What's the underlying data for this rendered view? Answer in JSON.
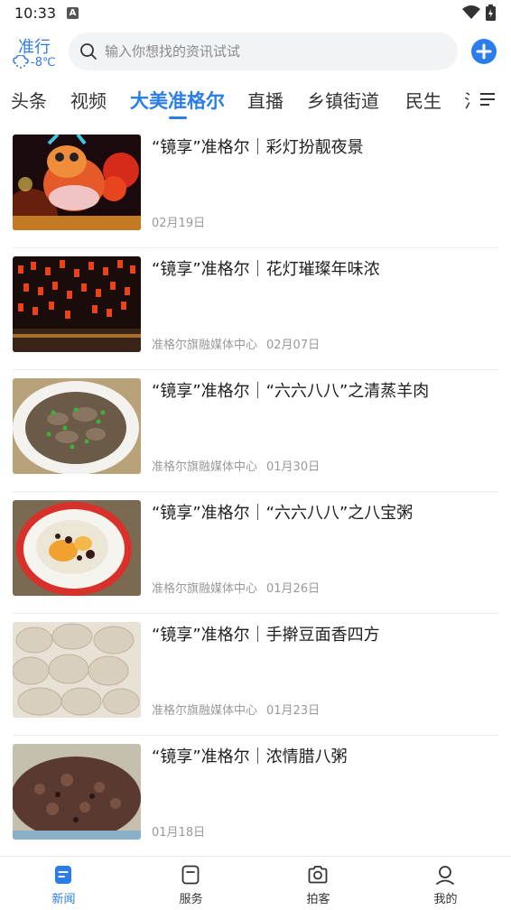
{
  "status_bar": {
    "time": "10:33",
    "notification_letter": "A"
  },
  "header": {
    "city": "准行",
    "temperature": "-8℃",
    "search_placeholder": "输入你想找的资讯试试"
  },
  "tabs": [
    {
      "label": "头条",
      "active": false
    },
    {
      "label": "视频",
      "active": false
    },
    {
      "label": "大美准格尔",
      "active": true
    },
    {
      "label": "直播",
      "active": false
    },
    {
      "label": "乡镇街道",
      "active": false
    },
    {
      "label": "民生",
      "active": false
    },
    {
      "label": "法",
      "active": false
    }
  ],
  "news": [
    {
      "title": "“镜享”准格尔｜彩灯扮靓夜景",
      "source": "",
      "date": "02月19日",
      "thumb_icon": "lantern-festival-image"
    },
    {
      "title": "“镜享”准格尔｜花灯璀璨年味浓",
      "source": "准格尔旗融媒体中心",
      "date": "02月07日",
      "thumb_icon": "lanterns-street-image"
    },
    {
      "title": "“镜享”准格尔｜“六六八八”之清蒸羊肉",
      "source": "准格尔旗融媒体中心",
      "date": "01月30日",
      "thumb_icon": "steamed-mutton-image"
    },
    {
      "title": "“镜享”准格尔｜“六六八八”之八宝粥",
      "source": "准格尔旗融媒体中心",
      "date": "01月26日",
      "thumb_icon": "eight-treasure-porridge-image"
    },
    {
      "title": "“镜享”准格尔｜手擀豆面香四方",
      "source": "准格尔旗融媒体中心",
      "date": "01月23日",
      "thumb_icon": "bean-noodles-image"
    },
    {
      "title": "“镜享”准格尔｜浓情腊八粥",
      "source": "",
      "date": "01月18日",
      "thumb_icon": "laba-porridge-image"
    }
  ],
  "bottom_nav": [
    {
      "label": "新闻",
      "icon": "news-icon",
      "active": true
    },
    {
      "label": "服务",
      "icon": "service-icon",
      "active": false
    },
    {
      "label": "拍客",
      "icon": "camera-icon",
      "active": false
    },
    {
      "label": "我的",
      "icon": "profile-icon",
      "active": false
    }
  ],
  "colors": {
    "accent": "#2b7de9",
    "text": "#1e1e1e",
    "meta": "#999999"
  }
}
